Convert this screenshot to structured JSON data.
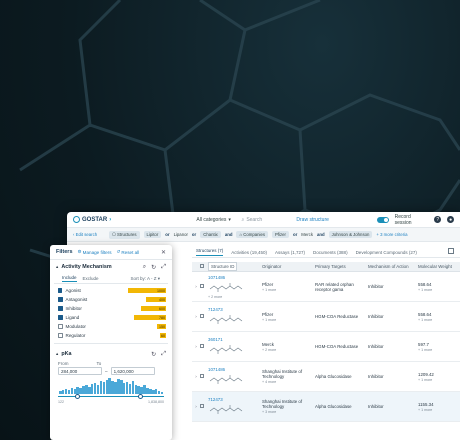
{
  "brand": {
    "name": "GOSTAR",
    "accent": "#19a0c8"
  },
  "topbar": {
    "category": "All categories",
    "search_placeholder": "Search",
    "draw_link": "Draw structure",
    "record_label": "Record session",
    "help": "?"
  },
  "searchbar": {
    "edit_search": "Edit search",
    "chips": [
      "Structures",
      "Lipitor",
      "Lipanor",
      "Chantix",
      "Companies",
      "Pfizer",
      "Merck",
      "Johnson & Johnson"
    ],
    "ops": [
      "or",
      "or",
      "and",
      "or",
      "and"
    ],
    "more_criteria": "+ 3 more criteria"
  },
  "tabs": [
    "Structures (7)",
    "Activities (19,450)",
    "Assays (1,727)",
    "Documents (388)",
    "Development Compounds (27)"
  ],
  "table": {
    "headers": [
      "Structure ID",
      "Originator",
      "Primary Targets",
      "Mechanism of Action",
      "Molecular Weight"
    ],
    "sort_indicator": "",
    "rows": [
      {
        "id": "1071486",
        "more": "+ 2 more",
        "originator": "Pfizer",
        "org_more": "+ 1 more",
        "target": "RAR related orphan receptor gama",
        "mechanism": "Inhibitor",
        "mw": "558.64",
        "mw_more": "+ 1 more"
      },
      {
        "id": "712473",
        "more": "",
        "originator": "Pfizer",
        "org_more": "+ 1 more",
        "target": "HGM-COA Reductase",
        "mechanism": "Inhibitor",
        "mw": "558.64",
        "mw_more": "+ 1 more"
      },
      {
        "id": "360171",
        "more": "",
        "originator": "Merck",
        "org_more": "+ 2 more",
        "target": "HGM-COA Reductase",
        "mechanism": "Inhibitor",
        "mw": "597.7",
        "mw_more": "+ 1 more"
      },
      {
        "id": "1071486",
        "more": "",
        "originator": "Shanghai Institute of Technology",
        "org_more": "+ 4 more",
        "target": "Alpha Glucosidase",
        "mechanism": "Inhibitor",
        "mw": "1209.42",
        "mw_more": "+ 1 more"
      },
      {
        "id": "712473",
        "more": "",
        "originator": "Shanghai Institute of Technology",
        "org_more": "+ 3 more",
        "target": "Alpha Glucosidase",
        "mechanism": "Inhibitor",
        "mw": "1155.34",
        "mw_more": "+ 1 more"
      }
    ]
  },
  "filters": {
    "title": "Filters",
    "manage": "Manage filters",
    "reset": "Reset all",
    "activity": {
      "title": "Activity Mechanism",
      "include": "Include",
      "exclude": "Exclude",
      "sort": "Sort by: A - Z",
      "items": [
        {
          "label": "Agonist",
          "count": "1000",
          "checked": true,
          "level": 0.95
        },
        {
          "label": "Antagonist",
          "count": "400",
          "checked": true,
          "level": 0.5
        },
        {
          "label": "Inhibitor",
          "count": "600",
          "checked": true,
          "level": 0.62
        },
        {
          "label": "Ligand",
          "count": "780",
          "checked": true,
          "level": 0.8
        },
        {
          "label": "Modulator",
          "count": "150",
          "checked": false,
          "level": 0.22
        },
        {
          "label": "Regulator",
          "count": "60",
          "checked": false,
          "level": 0.14
        }
      ]
    },
    "pka": {
      "title": "pKa",
      "from_label": "From",
      "to_label": "To",
      "from": "284,000",
      "to": "1,620,000",
      "min": "122",
      "max": "1,838,800",
      "low_fraction": 0.18,
      "high_fraction": 0.78,
      "histogram": [
        3,
        4,
        5,
        4,
        6,
        5,
        7,
        6,
        8,
        9,
        7,
        10,
        11,
        9,
        13,
        12,
        14,
        16,
        13,
        12,
        15,
        14,
        11,
        12,
        10,
        13,
        9,
        8,
        7,
        9,
        6,
        5,
        4,
        5,
        3,
        2
      ]
    }
  }
}
